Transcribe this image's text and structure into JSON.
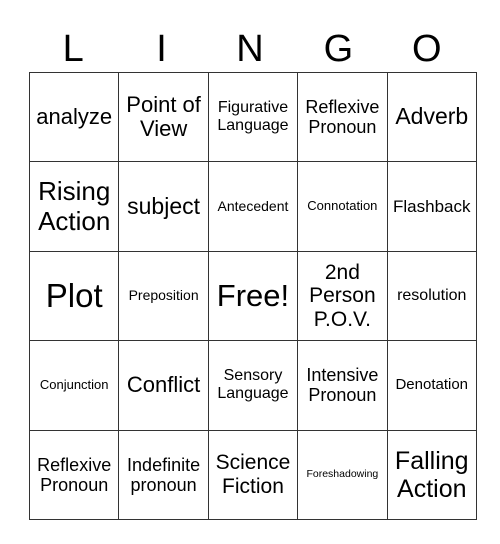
{
  "header": {
    "letters": [
      "L",
      "I",
      "N",
      "G",
      "O"
    ]
  },
  "rows": [
    [
      "analyze",
      "Point of View",
      "Figurative Language",
      "Reflexive Pronoun",
      "Adverb"
    ],
    [
      "Rising Action",
      "subject",
      "Antecedent",
      "Connotation",
      "Flashback"
    ],
    [
      "Plot",
      "Preposition",
      "Free!",
      "2nd Person P.O.V.",
      "resolution"
    ],
    [
      "Conjunction",
      "Conflict",
      "Sensory Language",
      "Intensive Pronoun",
      "Denotation"
    ],
    [
      "Reflexive Pronoun",
      "Indefinite pronoun",
      "Science Fiction",
      "Foreshadowing",
      "Falling Action"
    ]
  ]
}
